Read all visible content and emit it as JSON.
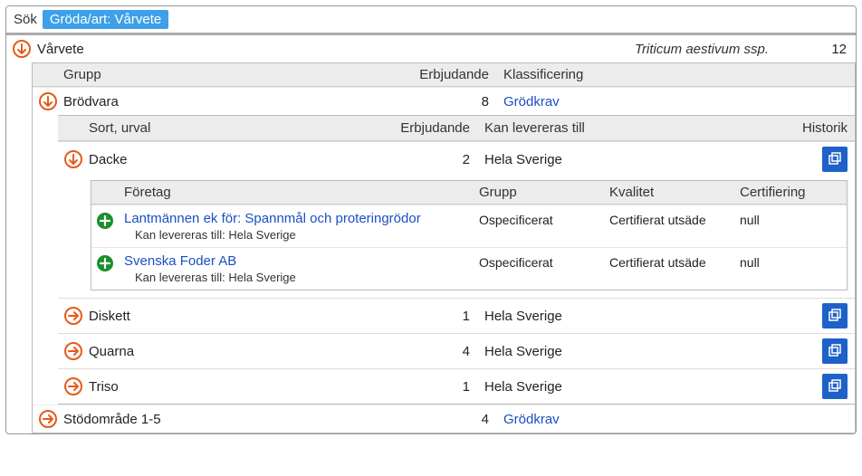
{
  "search": {
    "label": "Sök",
    "chip": "Gröda/art: Vårvete"
  },
  "crop": {
    "name": "Vårvete",
    "scientific": "Triticum aestivum ssp.",
    "count": "12"
  },
  "group_header": {
    "group": "Grupp",
    "offer": "Erbjudande",
    "classification": "Klassificering"
  },
  "groups": [
    {
      "name": "Brödvara",
      "offer": "8",
      "classification": "Grödkrav"
    },
    {
      "name": "Stödområde 1-5",
      "offer": "4",
      "classification": "Grödkrav"
    }
  ],
  "sort_header": {
    "sort": "Sort, urval",
    "offer": "Erbjudande",
    "deliver": "Kan levereras till",
    "history": "Historik"
  },
  "sorts": [
    {
      "name": "Dacke",
      "offer": "2",
      "deliver": "Hela Sverige"
    },
    {
      "name": "Diskett",
      "offer": "1",
      "deliver": "Hela Sverige"
    },
    {
      "name": "Quarna",
      "offer": "4",
      "deliver": "Hela Sverige"
    },
    {
      "name": "Triso",
      "offer": "1",
      "deliver": "Hela Sverige"
    }
  ],
  "company_header": {
    "company": "Företag",
    "group": "Grupp",
    "quality": "Kvalitet",
    "cert": "Certifiering"
  },
  "deliver_prefix": "Kan levereras till: ",
  "companies": [
    {
      "name": "Lantmännen ek för: Spannmål och proteringrödor",
      "deliver": "Hela Sverige",
      "group": "Ospecificerat",
      "quality": "Certifierat utsäde",
      "cert": "null"
    },
    {
      "name": "Svenska Foder AB",
      "deliver": "Hela Sverige",
      "group": "Ospecificerat",
      "quality": "Certifierat utsäde",
      "cert": "null"
    }
  ]
}
